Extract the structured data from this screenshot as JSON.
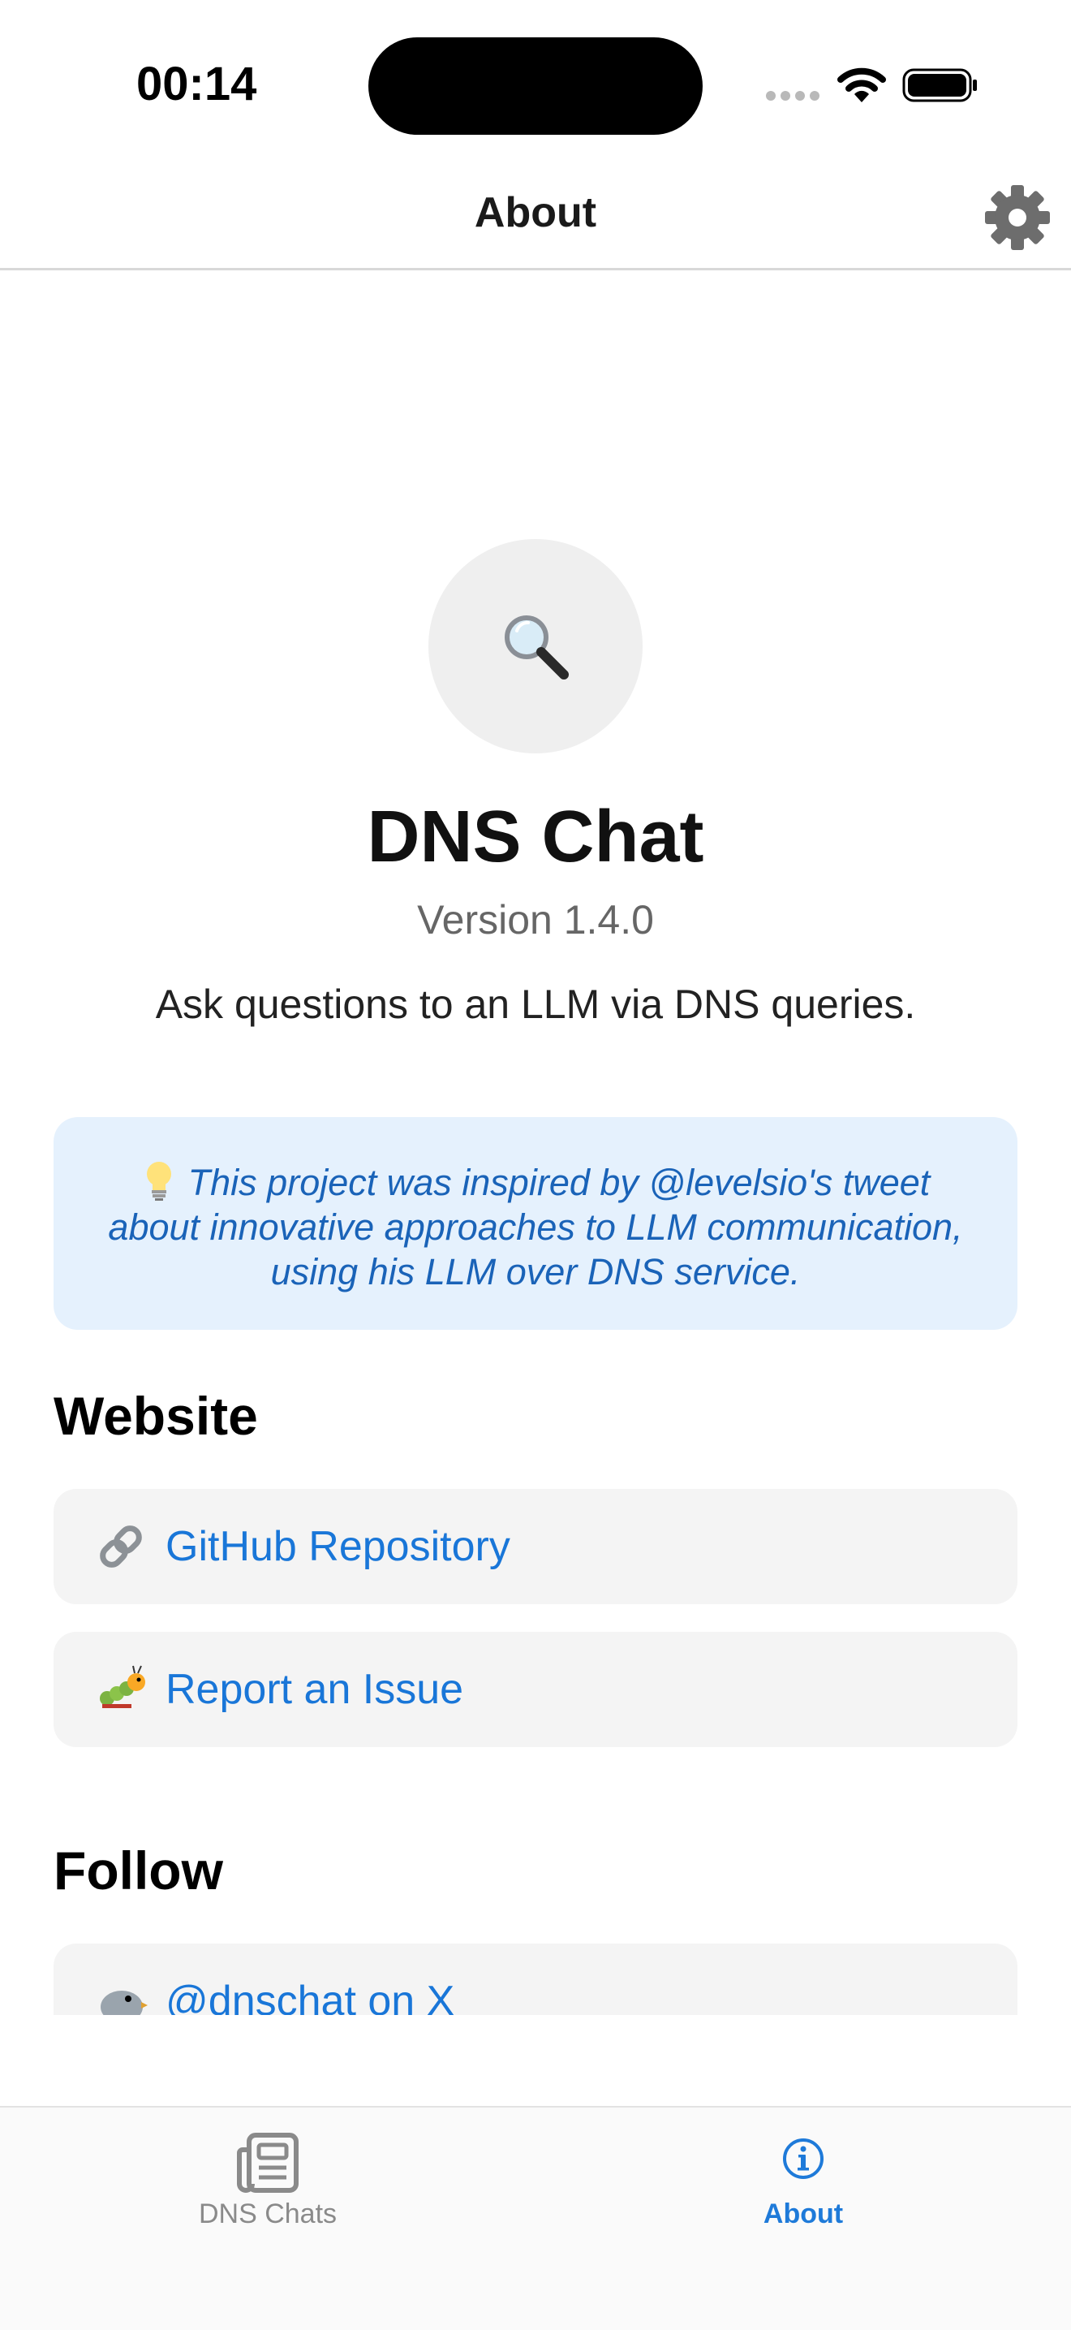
{
  "status_bar": {
    "time": "00:14"
  },
  "header": {
    "title": "About",
    "settings_icon": "gear-icon"
  },
  "hero": {
    "logo_icon": "magnifying-glass-icon",
    "app_name": "DNS Chat",
    "version": "Version 1.4.0",
    "tagline": "Ask questions to an LLM via DNS queries."
  },
  "info": {
    "icon": "lightbulb-icon",
    "text": "This project was inspired by @levelsio's tweet about innovative approaches to LLM communication, using his LLM over DNS service."
  },
  "website": {
    "heading": "Website",
    "links": [
      {
        "icon": "link-icon",
        "label": "GitHub Repository"
      },
      {
        "icon": "bug-icon",
        "label": "Report an Issue"
      }
    ]
  },
  "follow": {
    "heading": "Follow",
    "links": [
      {
        "icon": "bird-icon",
        "label": "@dnschat on X"
      }
    ]
  },
  "tabs": [
    {
      "label": "DNS Chats",
      "icon": "newspaper-icon",
      "active": false
    },
    {
      "label": "About",
      "icon": "info-circle-icon",
      "active": true
    }
  ],
  "colors": {
    "accent": "#1e7ad9",
    "info_bg": "#e5f1fd",
    "card_bg": "#f4f4f4"
  }
}
